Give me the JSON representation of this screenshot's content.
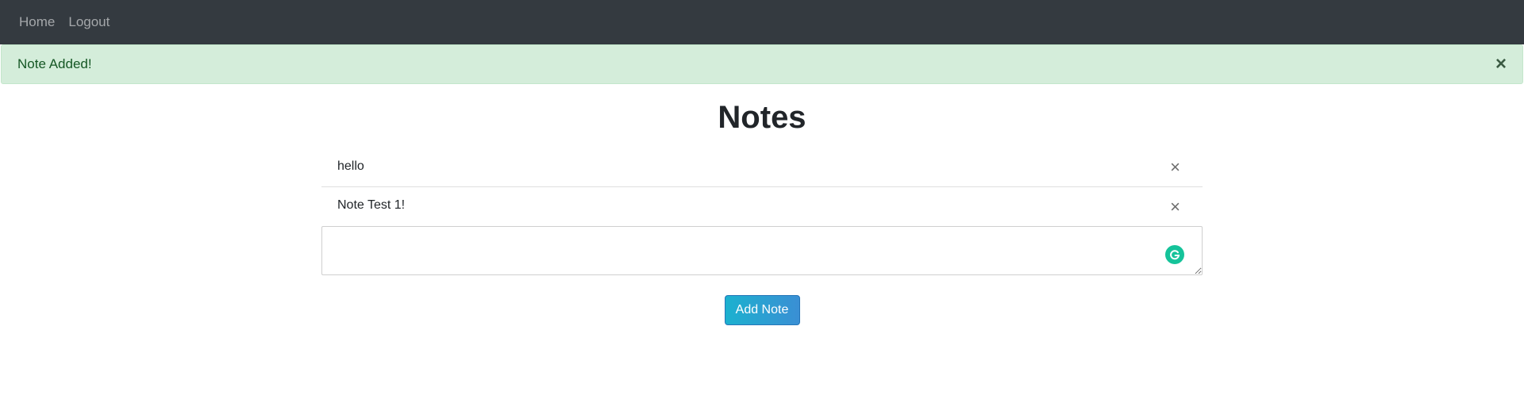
{
  "nav": {
    "items": [
      {
        "label": "Home"
      },
      {
        "label": "Logout"
      }
    ]
  },
  "alert": {
    "message": "Note Added!",
    "close_symbol": "×",
    "color": "#155724",
    "background": "#d4edda"
  },
  "page": {
    "title": "Notes"
  },
  "notes": [
    {
      "text": "hello",
      "delete_symbol": "×"
    },
    {
      "text": "Note Test 1!",
      "delete_symbol": "×"
    }
  ],
  "editor": {
    "value": "",
    "icon": "grammarly-icon"
  },
  "actions": {
    "add_label": "Add Note",
    "accent": "#1cb1cf"
  },
  "colors": {
    "navbar": "#343a40"
  }
}
